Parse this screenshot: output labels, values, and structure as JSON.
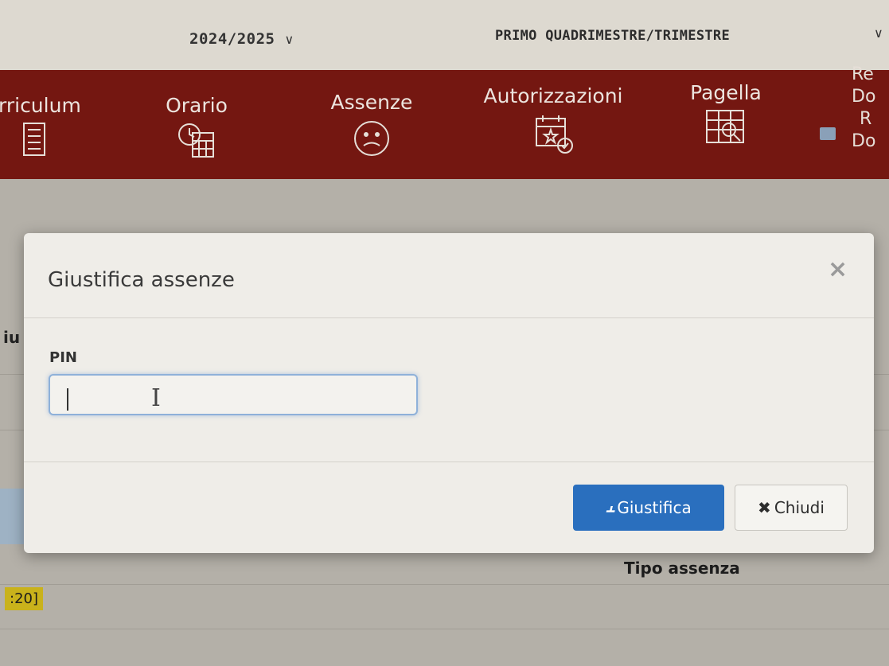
{
  "topbar": {
    "year": "2024/2025",
    "period": "PRIMO QUADRIMESTRE/TRIMESTRE"
  },
  "nav": {
    "items": [
      {
        "label": "rriculum",
        "icon": "document-icon"
      },
      {
        "label": "Orario",
        "icon": "clock-calendar-icon"
      },
      {
        "label": "Assenze",
        "icon": "sad-face-icon"
      },
      {
        "label": "Autorizzazioni",
        "icon": "calendar-check-icon"
      },
      {
        "label": "Pagella",
        "icon": "report-card-icon"
      }
    ],
    "right_labels": [
      "Re",
      "Do",
      "R",
      "Do"
    ]
  },
  "background": {
    "side_fragment": "iu",
    "column_header": "Tipo assenza",
    "time_badge": ":20]"
  },
  "modal": {
    "title": "Giustifica assenze",
    "close_label": "×",
    "pin_label": "PIN",
    "pin_value": "",
    "primary_button": "Giustifica",
    "secondary_button": "Chiudi",
    "primary_color": "#2a6fbe"
  }
}
